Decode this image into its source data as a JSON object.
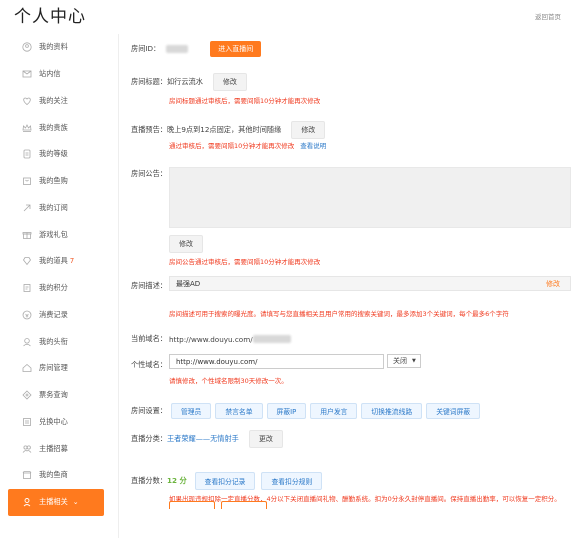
{
  "header": {
    "title": "个人中心",
    "back": "返回首页"
  },
  "sidebar": {
    "items": [
      {
        "label": "我的资料",
        "icon": "user-icon"
      },
      {
        "label": "站内信",
        "icon": "mail-icon"
      },
      {
        "label": "我的关注",
        "icon": "heart-icon"
      },
      {
        "label": "我的贵族",
        "icon": "crown-icon"
      },
      {
        "label": "我的等级",
        "icon": "level-icon"
      },
      {
        "label": "我的鱼购",
        "icon": "shop-icon"
      },
      {
        "label": "我的订阅",
        "icon": "subscribe-icon"
      },
      {
        "label": "游戏礼包",
        "icon": "gift-icon"
      },
      {
        "label": "我的道具",
        "icon": "item-icon",
        "badge": "7"
      },
      {
        "label": "我的积分",
        "icon": "points-icon"
      },
      {
        "label": "消费记录",
        "icon": "record-icon"
      },
      {
        "label": "我的头衔",
        "icon": "title-icon"
      },
      {
        "label": "房间管理",
        "icon": "room-icon"
      },
      {
        "label": "票务查询",
        "icon": "ticket-icon"
      },
      {
        "label": "兑换中心",
        "icon": "exchange-icon"
      },
      {
        "label": "主播招募",
        "icon": "recruit-icon"
      },
      {
        "label": "我的鱼商",
        "icon": "store-icon"
      }
    ],
    "active": {
      "label": "主播相关",
      "caret": "⌄"
    }
  },
  "form": {
    "room_id": {
      "label": "房间ID：",
      "enter_btn": "进入直播间"
    },
    "room_title": {
      "label": "房间标题：",
      "value": "如行云流水",
      "edit": "修改",
      "note": "房间标题通过审核后，需要间隔10分钟才能再次修改"
    },
    "preview": {
      "label": "直播预告：",
      "value": "晚上9点到12点固定，其他时间随缘",
      "edit": "修改",
      "note": "通过审核后，需要间隔10分钟才能再次修改",
      "link": "查看说明"
    },
    "notice": {
      "label": "房间公告：",
      "edit": "修改",
      "note": "房间公告通过审核后，需要间隔10分钟才能再次修改"
    },
    "desc": {
      "label": "房间描述：",
      "value": "最强AD",
      "edit": "修改",
      "note": "房间描述可用于搜索的曝光度。请填写与您直播相关且用户常用的搜索关键词，最多添加3个关键词，每个最多6个字符"
    },
    "domain": {
      "label": "当前域名：",
      "value": "http://www.douyu.com/"
    },
    "custom_domain": {
      "label": "个性域名：",
      "prefix": "http://www.douyu.com/",
      "select": "关闭",
      "note": "请慎修改，个性域名限制30天修改一次。"
    },
    "settings": {
      "label": "房间设置：",
      "buttons": [
        "管理员",
        "禁言名单",
        "屏蔽IP",
        "用户发言",
        "切换推流线路",
        "关键词屏蔽"
      ]
    },
    "category": {
      "label": "直播分类：",
      "value": "王者荣耀——无情射手",
      "edit": "更改"
    },
    "score": {
      "label": "直播分数：",
      "value": "12 分",
      "btn1": "查看扣分记录",
      "btn2": "查看扣分规则",
      "note": "如果出现违规扣除一定直播分数，4分以下关闭直播间礼物、酬勤系统。扣为0分永久封停直播间。保持直播出勤率，可以恢复一定积分。"
    }
  },
  "colors": {
    "accent": "#ff7a1e",
    "link": "#2a78c8",
    "warn": "#f0391e"
  }
}
